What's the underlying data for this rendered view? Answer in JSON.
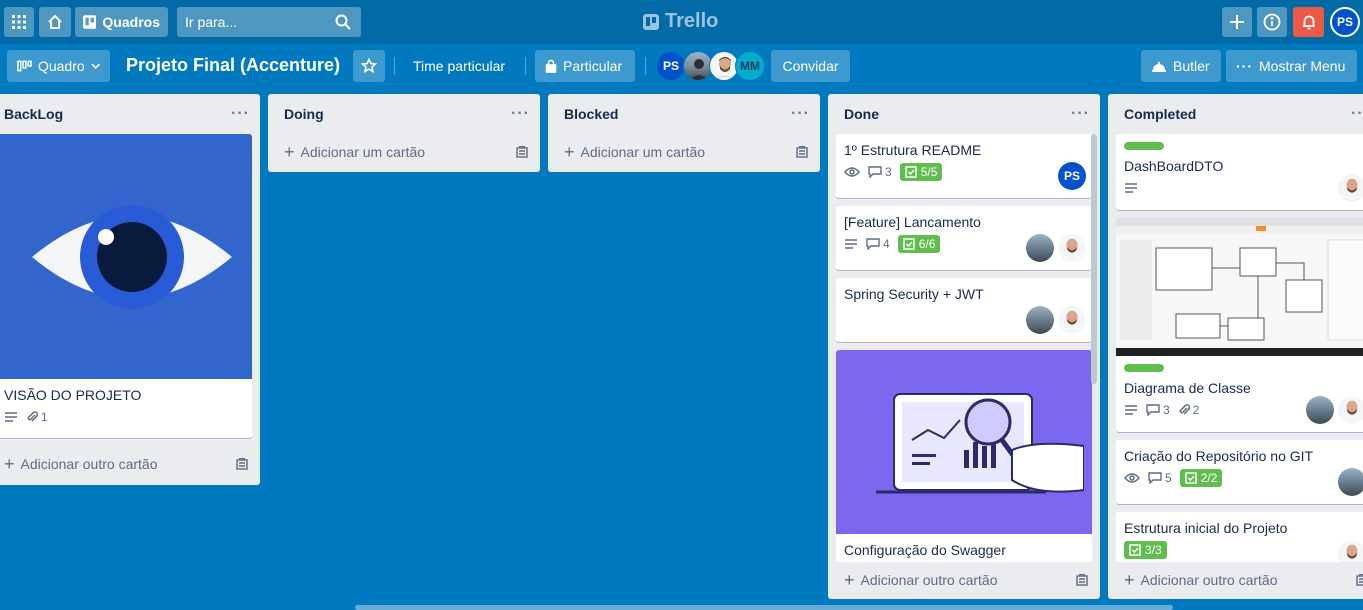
{
  "topbar": {
    "boards_label": "Quadros",
    "search_placeholder": "Ir para...",
    "logo_text": "Trello",
    "user_initials": "PS"
  },
  "board_header": {
    "view_label": "Quadro",
    "title": "Projeto Final (Accenture)",
    "team_label": "Time particular",
    "visibility_label": "Particular",
    "member_initials": [
      "PS",
      "MM"
    ],
    "invite_label": "Convidar",
    "butler_label": "Butler",
    "menu_label": "Mostrar Menu"
  },
  "lists": {
    "backlog": {
      "name": "BackLog",
      "cards": [
        {
          "title": "VISÃO DO PROJETO",
          "attachments": "1"
        }
      ],
      "add_label": "Adicionar outro cartão"
    },
    "doing": {
      "name": "Doing",
      "add_label": "Adicionar um cartão"
    },
    "blocked": {
      "name": "Blocked",
      "add_label": "Adicionar um cartão"
    },
    "done": {
      "name": "Done",
      "cards": [
        {
          "title": "1º Estrutura README",
          "comments": "3",
          "checklist": "5/5",
          "member": "PS"
        },
        {
          "title": "[Feature] Lancamento",
          "comments": "4",
          "checklist": "6/6"
        },
        {
          "title": "Spring Security + JWT"
        },
        {
          "title": "Configuração do Swagger"
        }
      ],
      "add_label": "Adicionar outro cartão"
    },
    "completed": {
      "name": "Completed",
      "cards": [
        {
          "title": "DashBoardDTO"
        },
        {
          "title": "Diagrama de Classe",
          "comments": "3",
          "attachments": "2"
        },
        {
          "title": "Criação do Repositório no GIT",
          "comments": "5",
          "checklist": "2/2"
        },
        {
          "title": "Estrutura inicial do Projeto",
          "checklist": "3/3"
        }
      ],
      "add_label": "Adicionar outro cartão"
    }
  },
  "colors": {
    "board_bg": "#0079bf",
    "topbar_bg": "#026aa7",
    "label_green": "#61bd4f",
    "notification_red": "#eb5a46",
    "avatar_blue": "#0052cc",
    "avatar_teal": "#00aecc"
  },
  "icons": [
    "apps-icon",
    "home-icon",
    "board-icon",
    "search-icon",
    "plus-icon",
    "info-icon",
    "bell-icon",
    "star-icon",
    "lock-icon",
    "butler-icon",
    "eye-icon",
    "comment-icon",
    "checklist-icon",
    "description-icon",
    "attachment-icon",
    "template-icon"
  ]
}
